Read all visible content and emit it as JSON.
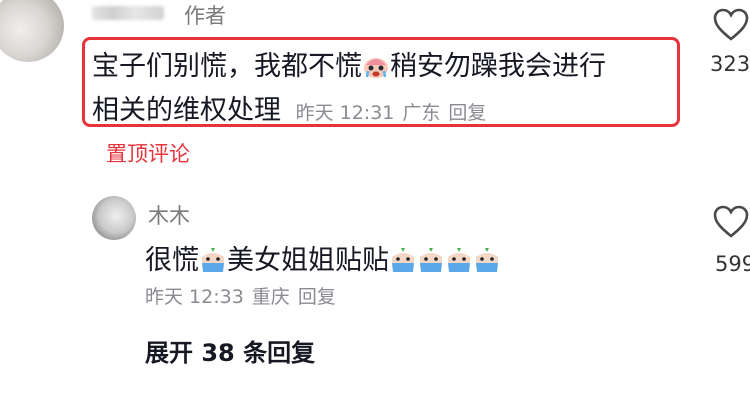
{
  "top_comment": {
    "author_tag": "作者",
    "line1": "宝子们别慌，我都不慌",
    "emoji1": "crying-face-emoji",
    "line1_rest": "稍安勿躁我会进行",
    "line2": "相关的维权处理",
    "time": "昨天 12:31",
    "location": "广东",
    "reply_label": "回复",
    "pinned_label": "置顶评论",
    "like_count": "323"
  },
  "reply": {
    "username": "木木",
    "text_part1": "很慌",
    "text_part2": "美女姐姐贴贴",
    "time": "昨天 12:33",
    "location": "重庆",
    "reply_label": "回复",
    "like_count": "599"
  },
  "expand_label": "展开 38 条回复",
  "colors": {
    "highlight_border": "#e8333c",
    "pinned_text": "#e8333c",
    "meta_text": "#8a8b91",
    "body_text": "#161823"
  }
}
